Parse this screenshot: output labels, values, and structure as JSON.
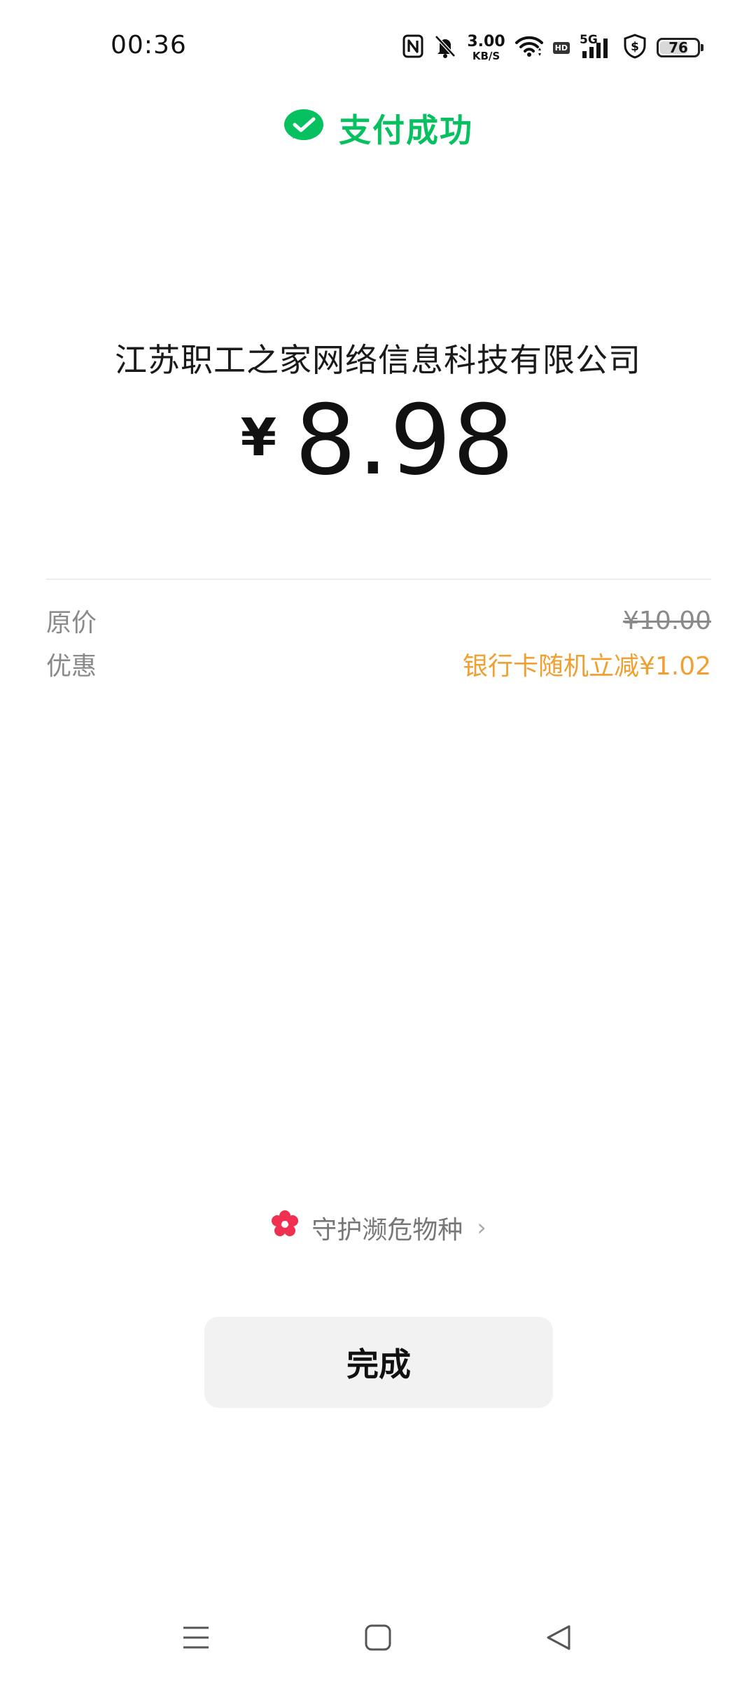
{
  "status_bar": {
    "time": "00:36",
    "net_speed_value": "3.00",
    "net_speed_unit": "KB/S",
    "hd_label": "HD",
    "network_type": "5G",
    "battery_level": "76",
    "icons": [
      "nfc-icon",
      "bell-muted-icon",
      "wifi-icon",
      "hd-icon",
      "signal-5g-icon",
      "shield-dollar-icon",
      "battery-icon"
    ]
  },
  "header": {
    "title": "支付成功",
    "icon": "wechat-pay-icon",
    "accent_color": "#07c160"
  },
  "payment": {
    "merchant": "江苏职工之家网络信息科技有限公司",
    "currency_symbol": "¥",
    "amount": "8.98"
  },
  "details": [
    {
      "label": "原价",
      "value": "¥10.00",
      "style": "strikethrough"
    },
    {
      "label": "优惠",
      "value": "银行卡随机立减¥1.02",
      "style": "highlight",
      "color": "#f0a030"
    }
  ],
  "promo_link": {
    "label": "守护濒危物种",
    "icon": "flower-icon",
    "icon_color": "#f03050"
  },
  "actions": {
    "done_label": "完成"
  },
  "navigation": {
    "icons": [
      "menu-icon",
      "home-square-icon",
      "back-triangle-icon"
    ]
  }
}
